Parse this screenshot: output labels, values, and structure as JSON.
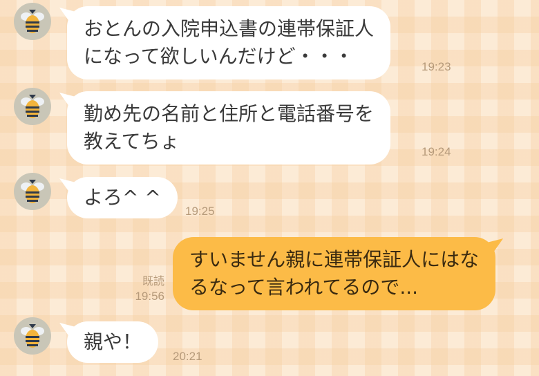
{
  "messages": [
    {
      "sender": "other",
      "lines": [
        "おとんの入院申込書の連帯保証人",
        "になって欲しいんだけど・・・"
      ],
      "time": "19:23"
    },
    {
      "sender": "other",
      "lines": [
        "勤め先の名前と住所と電話番号を",
        "教えてちょ"
      ],
      "time": "19:24"
    },
    {
      "sender": "other",
      "lines": [
        "よろ^ ^"
      ],
      "time": "19:25"
    },
    {
      "sender": "me",
      "lines": [
        "すいません親に連帯保証人にはな",
        "るなって言われてるので..."
      ],
      "time": "19:56",
      "read_label": "既読"
    },
    {
      "sender": "other",
      "lines": [
        "親や！"
      ],
      "time": "20:21"
    }
  ],
  "avatar": {
    "icon": "bee-icon"
  },
  "colors": {
    "background": "#fcebd6",
    "incoming_bubble": "#ffffff",
    "outgoing_bubble": "#fcbb47",
    "timestamp": "#b69a7a"
  }
}
